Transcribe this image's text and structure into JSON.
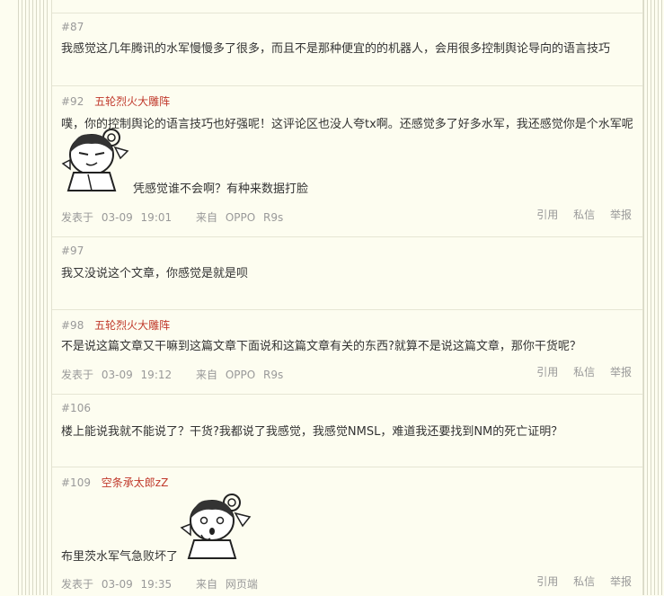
{
  "posts": [
    {
      "num": "#87",
      "author": "",
      "lines": [
        "我感觉这几年腾讯的水军慢慢多了很多，而且不是那种便宜的的机器人，会用很多控制舆论导向的语言技巧"
      ]
    },
    {
      "num": "#92",
      "author": "五轮烈火大雕阵",
      "lines": [
        "噗，你的控制舆论的语言技巧也好强呢！这评论区也没人夸tx啊。还感觉多了好多水军，我还感觉你是个水军呢",
        "凭感觉谁不会啊？有种来数据打脸"
      ],
      "sticker": "chibi-smirk-sticker",
      "footer": {
        "posted_label": "发表于",
        "date": "03-09",
        "time": "19:01",
        "from_label": "来自",
        "source1": "OPPO",
        "source2": "R9s"
      }
    },
    {
      "num": "#97",
      "author": "",
      "lines": [
        "我又没说这个文章，你感觉是就是呗"
      ]
    },
    {
      "num": "#98",
      "author": "五轮烈火大雕阵",
      "lines": [
        "不是说这篇文章又干嘛到这篇文章下面说和这篇文章有关的东西?就算不是说这篇文章，那你干货呢？"
      ],
      "footer": {
        "posted_label": "发表于",
        "date": "03-09",
        "time": "19:12",
        "from_label": "来自",
        "source1": "OPPO",
        "source2": "R9s"
      }
    },
    {
      "num": "#106",
      "author": "",
      "lines": [
        "楼上能说我就不能说了？干货?我都说了我感觉，我感觉NMSL，难道我还要找到NM的死亡证明？"
      ]
    },
    {
      "num": "#109",
      "author": "空条承太郎zZ",
      "lines": [
        "布里茨水军气急败坏了"
      ],
      "sticker": "chibi-shocked-sticker",
      "footer": {
        "posted_label": "发表于",
        "date": "03-09",
        "time": "19:35",
        "from_label": "来自",
        "source1": "网页端",
        "source2": ""
      }
    }
  ],
  "actions": {
    "quote": "引用",
    "message": "私信",
    "report": "举报"
  },
  "colors": {
    "background": "#fdfdf0",
    "author": "#c0392b",
    "muted": "#999999",
    "border": "#e6e6d4"
  }
}
